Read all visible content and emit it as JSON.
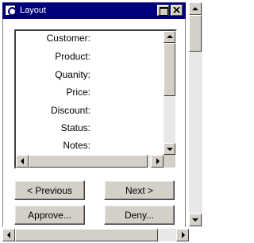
{
  "window": {
    "title": "Layout"
  },
  "fields": [
    {
      "label": "Customer:"
    },
    {
      "label": "Product:"
    },
    {
      "label": "Quanity:"
    },
    {
      "label": "Price:"
    },
    {
      "label": "Discount:"
    },
    {
      "label": "Status:"
    },
    {
      "label": "Notes:"
    }
  ],
  "buttons": {
    "previous": "< Previous",
    "next": "Next >",
    "approve": "Approve...",
    "deny": "Deny..."
  },
  "icons": {
    "window_icon": "app-icon",
    "maximize": "maximize-icon",
    "close": "close-icon"
  },
  "colors": {
    "titlebar": "#00007b",
    "face": "#d4d0c8",
    "background": "#ffffff"
  }
}
